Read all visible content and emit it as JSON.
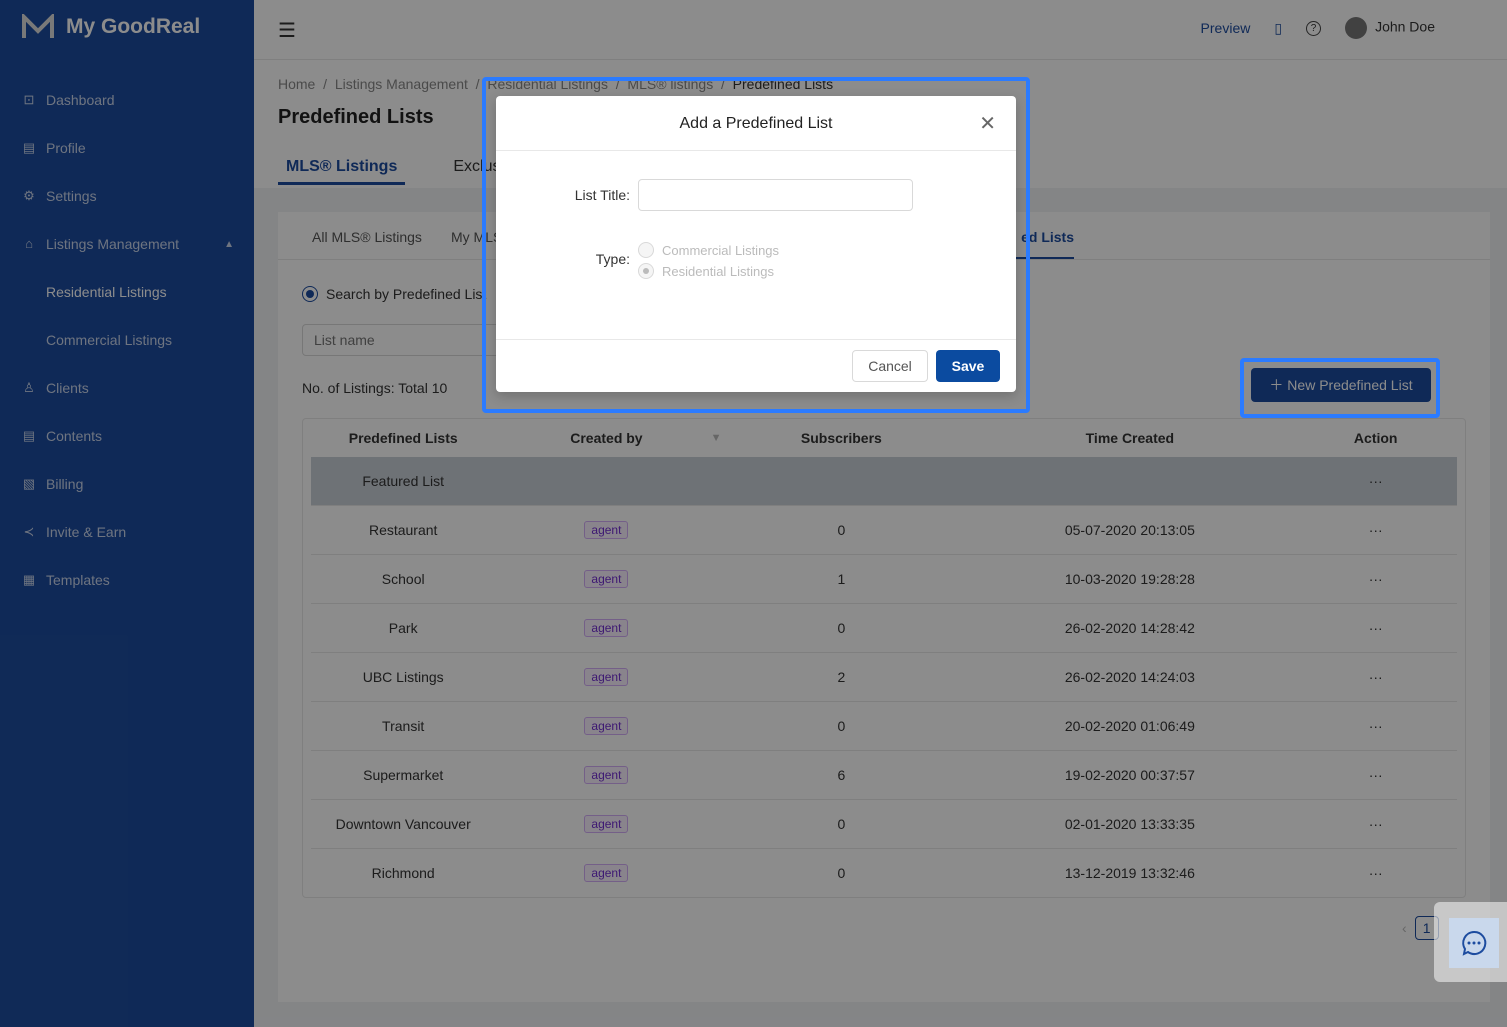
{
  "app": {
    "name": "My GoodReal"
  },
  "sidebar": {
    "items": [
      {
        "label": "Dashboard",
        "icon": "chart-icon"
      },
      {
        "label": "Profile",
        "icon": "profile-icon"
      },
      {
        "label": "Settings",
        "icon": "gear-icon"
      },
      {
        "label": "Listings Management",
        "icon": "home-icon"
      },
      {
        "label": "Residential Listings"
      },
      {
        "label": "Commercial Listings"
      },
      {
        "label": "Clients",
        "icon": "user-icon"
      },
      {
        "label": "Contents",
        "icon": "document-icon"
      },
      {
        "label": "Billing",
        "icon": "billing-icon"
      },
      {
        "label": "Invite & Earn",
        "icon": "share-icon"
      },
      {
        "label": "Templates",
        "icon": "template-icon"
      }
    ]
  },
  "topbar": {
    "preview": "Preview",
    "user": "John Doe"
  },
  "breadcrumb": [
    "Home",
    "Listings Management",
    "Residential Listings",
    "MLS® listings",
    "Predefined Lists"
  ],
  "page": {
    "title": "Predefined Lists",
    "tabs": [
      "MLS® Listings",
      "Exclusive"
    ]
  },
  "subtabs": [
    "All MLS® Listings",
    "My MLS",
    "ed Lists"
  ],
  "search": {
    "radio_label": "Search by Predefined List",
    "placeholder": "List name"
  },
  "count": "No. of Listings: Total 10",
  "new_button": "New Predefined List",
  "table": {
    "headers": [
      "Predefined Lists",
      "Created by",
      "Subscribers",
      "Time Created",
      "Action"
    ],
    "rows": [
      {
        "name": "Featured List",
        "by": "",
        "subs": "",
        "time": "",
        "action": "···"
      },
      {
        "name": "Restaurant",
        "by": "agent",
        "subs": "0",
        "time": "05-07-2020 20:13:05",
        "action": "···"
      },
      {
        "name": "School",
        "by": "agent",
        "subs": "1",
        "time": "10-03-2020 19:28:28",
        "action": "···"
      },
      {
        "name": "Park",
        "by": "agent",
        "subs": "0",
        "time": "26-02-2020 14:28:42",
        "action": "···"
      },
      {
        "name": "UBC Listings",
        "by": "agent",
        "subs": "2",
        "time": "26-02-2020 14:24:03",
        "action": "···"
      },
      {
        "name": "Transit",
        "by": "agent",
        "subs": "0",
        "time": "20-02-2020 01:06:49",
        "action": "···"
      },
      {
        "name": "Supermarket",
        "by": "agent",
        "subs": "6",
        "time": "19-02-2020 00:37:57",
        "action": "···"
      },
      {
        "name": "Downtown Vancouver",
        "by": "agent",
        "subs": "0",
        "time": "02-01-2020 13:33:35",
        "action": "···"
      },
      {
        "name": "Richmond",
        "by": "agent",
        "subs": "0",
        "time": "13-12-2019 13:32:46",
        "action": "···"
      }
    ]
  },
  "pagination": {
    "current": "1"
  },
  "modal": {
    "title": "Add a Predefined List",
    "list_title_label": "List Title:",
    "list_title_value": "",
    "type_label": "Type:",
    "options": [
      "Commercial Listings",
      "Residential Listings"
    ],
    "selected": "Residential Listings",
    "cancel": "Cancel",
    "save": "Save"
  },
  "colors": {
    "brand": "#1d4c9f",
    "highlight": "#2b7bff"
  }
}
